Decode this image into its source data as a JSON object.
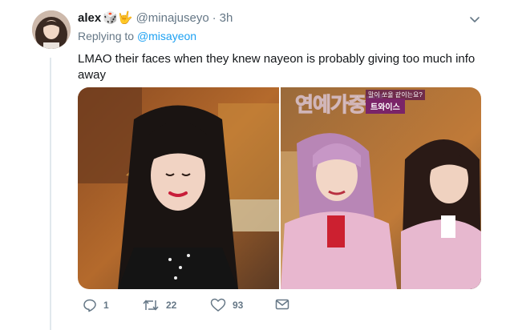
{
  "tweet": {
    "author_name": "alex",
    "author_emoji": "🎲🤟",
    "handle": "@minajuseyo",
    "separator": "·",
    "time": "3h",
    "replying_prefix": "Replying to",
    "replying_to": "@misayeon",
    "text": "LMAO their faces when they knew nayeon is probably giving too much info away"
  },
  "media": {
    "overlay_logo": "연예가중계",
    "overlay_caption_small": "말이 쏘울 같이는요?",
    "overlay_tag": "트와이스"
  },
  "actions": {
    "reply_count": "1",
    "retweet_count": "22",
    "like_count": "93"
  },
  "icons": {
    "reply": "reply-icon",
    "retweet": "retweet-icon",
    "like": "heart-icon",
    "message": "envelope-icon",
    "menu": "chevron-down-icon"
  },
  "colors": {
    "text_primary": "#14171a",
    "text_secondary": "#657786",
    "link": "#1da1f2",
    "divider": "#e1e8ed"
  }
}
